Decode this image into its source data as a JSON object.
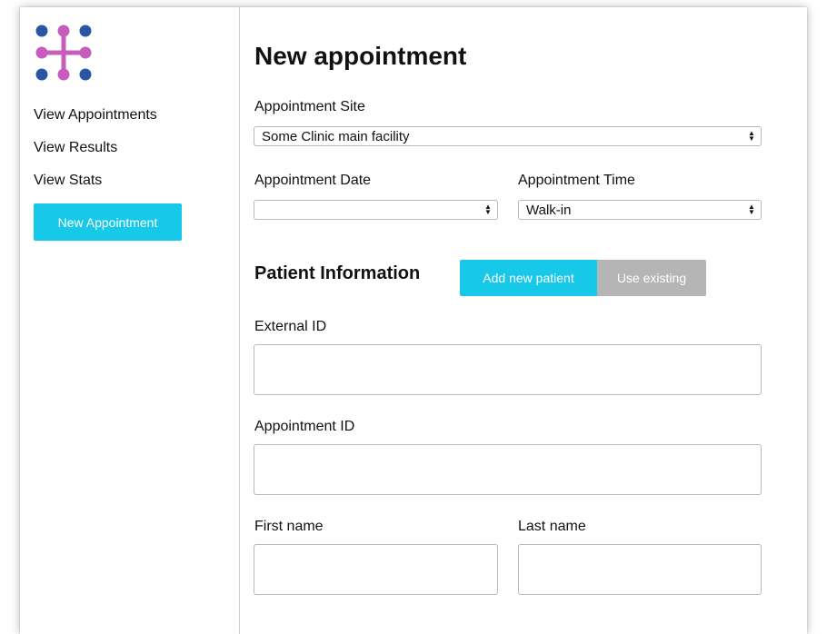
{
  "brand": {
    "logo_icon": "network-nodes-icon",
    "dot_colors": [
      "#2a56a5",
      "#c65dbd"
    ]
  },
  "sidebar": {
    "items": [
      {
        "label": "View Appointments"
      },
      {
        "label": "View Results"
      },
      {
        "label": "View Stats"
      }
    ],
    "new_appointment_label": "New Appointment",
    "accent_color": "#17c8e8"
  },
  "form": {
    "title": "New appointment",
    "site": {
      "label": "Appointment Site",
      "value": "Some Clinic main facility"
    },
    "date": {
      "label": "Appointment Date",
      "value": ""
    },
    "time": {
      "label": "Appointment Time",
      "value": "Walk-in"
    },
    "patient": {
      "section_title": "Patient Information",
      "toggle": {
        "active": "Add new patient",
        "inactive": "Use existing"
      }
    },
    "external_id": {
      "label": "External ID",
      "value": ""
    },
    "appointment_id": {
      "label": "Appointment ID",
      "value": ""
    },
    "first_name": {
      "label": "First name",
      "value": ""
    },
    "last_name": {
      "label": "Last name",
      "value": ""
    }
  }
}
